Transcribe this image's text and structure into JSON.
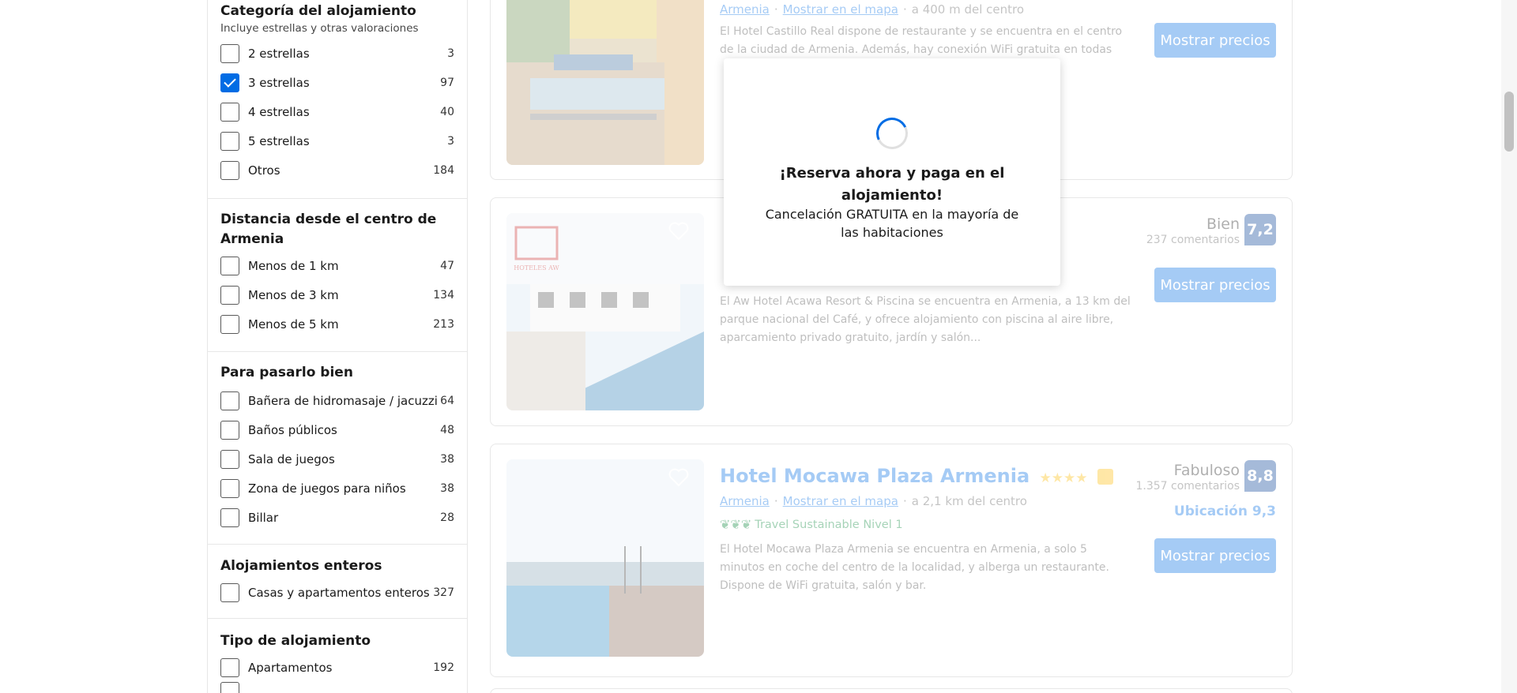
{
  "filters": {
    "category": {
      "title": "Categoría del alojamiento",
      "subtitle": "Incluye estrellas y otras valoraciones",
      "options": [
        {
          "label": "2 estrellas",
          "count": "3",
          "checked": false
        },
        {
          "label": "3 estrellas",
          "count": "97",
          "checked": true
        },
        {
          "label": "4 estrellas",
          "count": "40",
          "checked": false
        },
        {
          "label": "5 estrellas",
          "count": "3",
          "checked": false
        },
        {
          "label": "Otros",
          "count": "184",
          "checked": false
        }
      ]
    },
    "distance": {
      "title": "Distancia desde el centro de Armenia",
      "options": [
        {
          "label": "Menos de 1 km",
          "count": "47"
        },
        {
          "label": "Menos de 3 km",
          "count": "134"
        },
        {
          "label": "Menos de 5 km",
          "count": "213"
        }
      ]
    },
    "fun": {
      "title": "Para pasarlo bien",
      "options": [
        {
          "label": "Bañera de hidromasaje / jacuzzi",
          "count": "64"
        },
        {
          "label": "Baños públicos",
          "count": "48"
        },
        {
          "label": "Sala de juegos",
          "count": "38"
        },
        {
          "label": "Zona de juegos para niños",
          "count": "38"
        },
        {
          "label": "Billar",
          "count": "28"
        }
      ]
    },
    "entire": {
      "title": "Alojamientos enteros",
      "options": [
        {
          "label": "Casas y apartamentos enteros",
          "count": "327"
        }
      ]
    },
    "type": {
      "title": "Tipo de alojamiento",
      "options": [
        {
          "label": "Apartamentos",
          "count": "192"
        }
      ]
    }
  },
  "cards": [
    {
      "location": "Armenia",
      "map_link": "Mostrar en el mapa",
      "distance": "a 400 m del centro",
      "description": "El Hotel Castillo Real dispone de restaurante y se encuentra en el centro de la ciudad de Armenia. Además, hay conexión WiFi gratuita en todas las",
      "button": "Mostrar precios"
    },
    {
      "score_word": "Bien",
      "score_count": "237 comentarios",
      "score": "7,2",
      "description": "El Aw Hotel Acawa Resort & Piscina se encuentra en Armenia, a 13 km del parque nacional del Café, y ofrece alojamiento con piscina al aire libre, aparcamiento privado gratuito, jardín y salón...",
      "button": "Mostrar precios",
      "logo_text": "HOTELES AW"
    },
    {
      "name": "Hotel Mocawa Plaza Armenia",
      "stars": "★★★★",
      "location": "Armenia",
      "map_link": "Mostrar en el mapa",
      "distance": "a 2,1 km del centro",
      "sustainable": "Travel Sustainable Nivel 1",
      "score_word": "Fabuloso",
      "score_count": "1.357 comentarios",
      "score": "8,8",
      "location_score": "Ubicación 9,3",
      "description": "El Hotel Mocawa Plaza Armenia se encuentra en Armenia, a solo 5 minutos en coche del centro de la localidad, y alberga un restaurante. Dispone de WiFi gratuita, salón y bar.",
      "button": "Mostrar precios"
    }
  ],
  "modal": {
    "title": "¡Reserva ahora y paga en el alojamiento!",
    "subtitle": "Cancelación GRATUITA en la mayoría de las habitaciones"
  },
  "colors": {
    "brand_blue": "#006ce4",
    "score_blue": "#003b95",
    "eco_green": "#008234"
  }
}
